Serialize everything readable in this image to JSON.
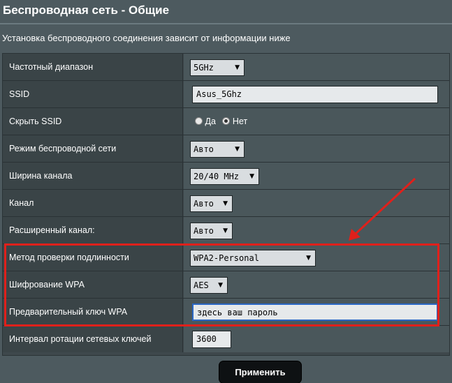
{
  "header": {
    "title": "Беспроводная сеть - Общие"
  },
  "description": "Установка беспроводного соединения зависит от информации ниже",
  "rows": [
    {
      "label": "Частотный диапазон",
      "type": "select",
      "value": "5GHz"
    },
    {
      "label": "SSID",
      "type": "input",
      "value": "Asus_5Ghz"
    },
    {
      "label": "Скрыть SSID",
      "type": "radio",
      "options": [
        "Да",
        "Нет"
      ],
      "selected": "Нет"
    },
    {
      "label": "Режим беспроводной сети",
      "type": "select",
      "value": "Авто"
    },
    {
      "label": "Ширина канала",
      "type": "select",
      "value": "20/40 MHz"
    },
    {
      "label": "Канал",
      "type": "select",
      "value": "Авто"
    },
    {
      "label": "Расширенный канал:",
      "type": "select",
      "value": "Авто"
    },
    {
      "label": "Метод проверки подлинности",
      "type": "select",
      "value": "WPA2-Personal"
    },
    {
      "label": "Шифрование WPA",
      "type": "select",
      "value": "AES"
    },
    {
      "label": "Предварительный ключ WPA",
      "type": "input",
      "value": "здесь ваш пароль"
    },
    {
      "label": "Интервал ротации сетевых ключей",
      "type": "input",
      "value": "3600"
    }
  ],
  "apply_button": "Применить",
  "colors": {
    "background": "#4d5a5f",
    "highlight": "#e0201b",
    "button": "#0e1113"
  }
}
